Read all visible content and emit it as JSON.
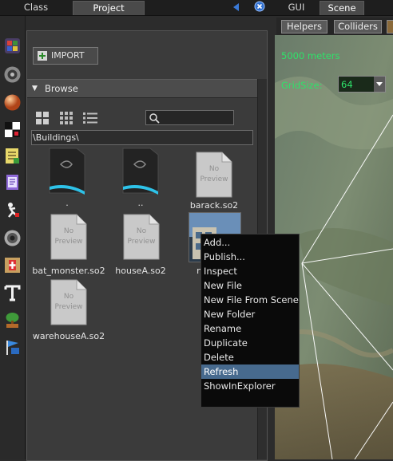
{
  "tabs": {
    "left": [
      "Class",
      "Project"
    ],
    "right": [
      "GUI",
      "Scene"
    ]
  },
  "project": {
    "import_label": "IMPORT",
    "browse_label": "Browse",
    "search_value": "",
    "path": "\\Buildings\\",
    "files": [
      {
        "name": "."
      },
      {
        "name": ".."
      },
      {
        "name": "barack.so2",
        "preview": [
          "No",
          "Preview"
        ]
      },
      {
        "name": "bat_monster.so2",
        "preview": [
          "No",
          "Preview"
        ]
      },
      {
        "name": "houseA.so2",
        "preview": [
          "No",
          "Preview"
        ]
      },
      {
        "name": "ne"
      },
      {
        "name": "warehouseA.so2",
        "preview": [
          "No",
          "Preview"
        ]
      }
    ]
  },
  "scene": {
    "buttons": [
      "Helpers",
      "Colliders"
    ],
    "distance": "5000 meters",
    "gridsize_label": "GridSize:",
    "gridsize_value": "64"
  },
  "context_menu": {
    "items": [
      "Add...",
      "Publish...",
      "Inspect",
      "New File",
      "New File From Scene",
      "New Folder",
      "Rename",
      "Duplicate",
      "Delete",
      "Refresh",
      "ShowInExplorer"
    ],
    "selected": "Refresh"
  },
  "colors": {
    "highlight": "#476a8e",
    "scene_text": "#2ee26a",
    "doc_icon": "#c9c9c9"
  }
}
